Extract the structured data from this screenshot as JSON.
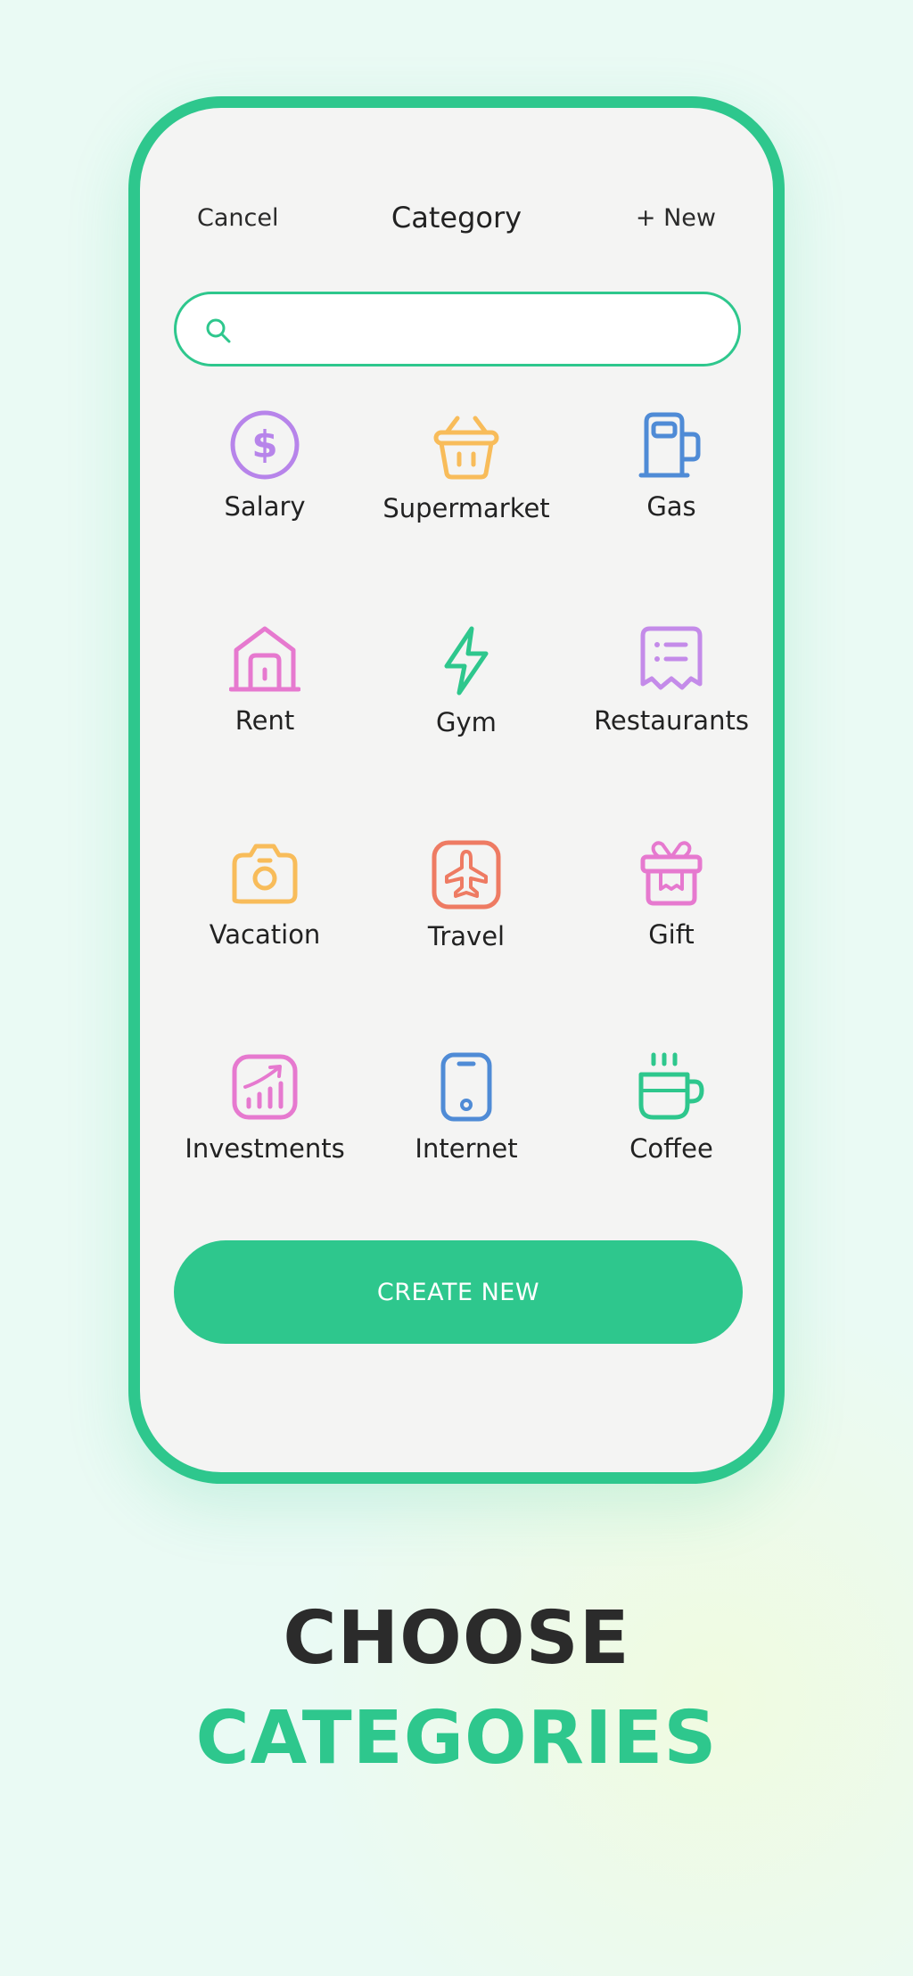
{
  "header": {
    "cancel_label": "Cancel",
    "title": "Category",
    "new_label": "+ New"
  },
  "search": {
    "placeholder": ""
  },
  "categories": [
    {
      "label": "Salary",
      "icon": "dollar-circle-icon",
      "color": "#b784ea"
    },
    {
      "label": "Supermarket",
      "icon": "shopping-basket-icon",
      "color": "#f8bc5a"
    },
    {
      "label": "Gas",
      "icon": "gas-pump-icon",
      "color": "#4f8bd6"
    },
    {
      "label": "Rent",
      "icon": "house-icon",
      "color": "#e679cf"
    },
    {
      "label": "Gym",
      "icon": "lightning-icon",
      "color": "#2ec78d"
    },
    {
      "label": "Restaurants",
      "icon": "receipt-icon",
      "color": "#c48be9"
    },
    {
      "label": "Vacation",
      "icon": "camera-icon",
      "color": "#f8bc5a"
    },
    {
      "label": "Travel",
      "icon": "airplane-icon",
      "color": "#ee7b63"
    },
    {
      "label": "Gift",
      "icon": "gift-icon",
      "color": "#e679cf"
    },
    {
      "label": "Investments",
      "icon": "chart-growth-icon",
      "color": "#e679cf"
    },
    {
      "label": "Internet",
      "icon": "smartphone-icon",
      "color": "#4f8bd6"
    },
    {
      "label": "Coffee",
      "icon": "coffee-cup-icon",
      "color": "#2ec78d"
    }
  ],
  "create_button": {
    "label": "CREATE NEW"
  },
  "promo": {
    "line1": "CHOOSE",
    "line2": "CATEGORIES"
  },
  "colors": {
    "accent": "#2ec78d",
    "dark_text": "#2b2b2b",
    "background": "#eafaf4"
  }
}
